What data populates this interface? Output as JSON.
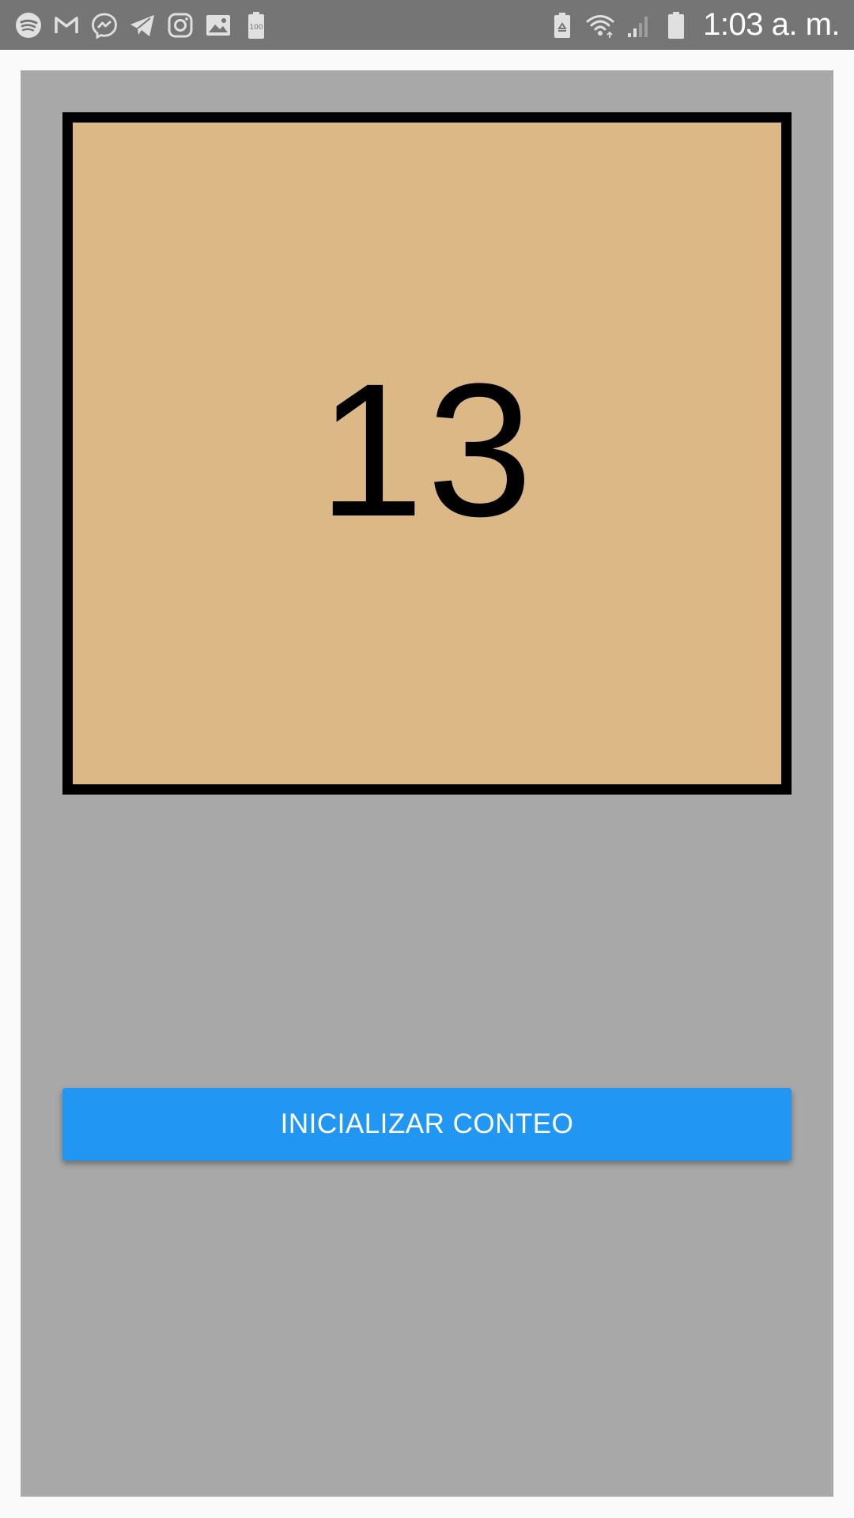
{
  "status_bar": {
    "time": "1:03 a. m.",
    "left_icons": [
      "spotify-icon",
      "gmail-icon",
      "messenger-icon",
      "telegram-icon",
      "instagram-icon",
      "gallery-icon",
      "battery-100-notification-icon"
    ],
    "right_icons": [
      "battery-saver-icon",
      "wifi-icon",
      "signal-icon",
      "battery-icon"
    ],
    "battery_notification_label": "100"
  },
  "counter": {
    "value": "13"
  },
  "actions": {
    "init_label": "INICIALIZAR CONTEO"
  },
  "colors": {
    "status_bar": "#757575",
    "content_background": "#a8a8a8",
    "counter_fill": "#ddb887",
    "counter_border": "#000000",
    "button": "#2196f3"
  }
}
